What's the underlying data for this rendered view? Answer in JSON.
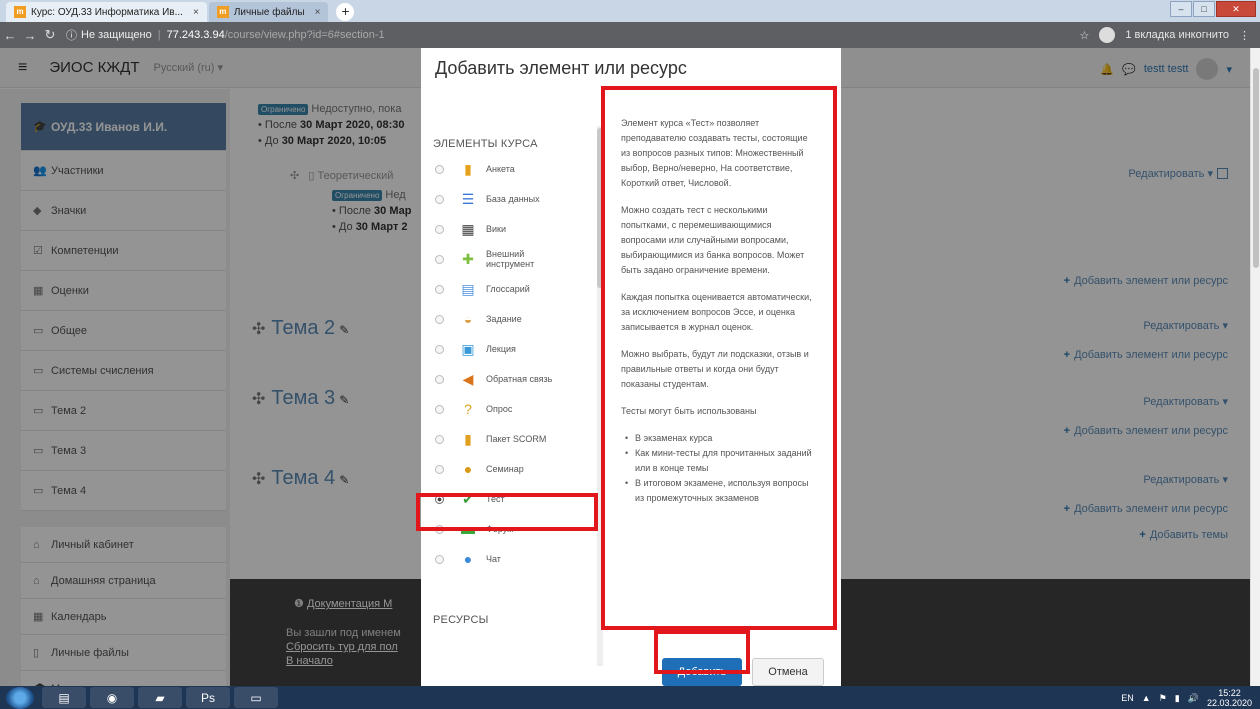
{
  "browser": {
    "tabs": [
      {
        "label": "Курс: ОУД.33 Информатика Ив...",
        "active": true
      },
      {
        "label": "Личные файлы",
        "active": false
      }
    ],
    "address": {
      "insecure_label": "Не защищено",
      "host": "77.243.3.94",
      "path": "/course/view.php?id=6#section-1"
    },
    "incognito_label": "1 вкладка инкогнито"
  },
  "header": {
    "brand": "ЭИОС КЖДТ",
    "language": "Русский (ru) ▾",
    "user": "testt testt"
  },
  "sidebar": {
    "items": [
      {
        "icon": "graduation-cap-icon",
        "glyph": "🎓",
        "label": "ОУД.33 Иванов И.И."
      },
      {
        "icon": "users-icon",
        "glyph": "👥",
        "label": "Участники"
      },
      {
        "icon": "badge-icon",
        "glyph": "◆",
        "label": "Значки"
      },
      {
        "icon": "checklist-icon",
        "glyph": "☑",
        "label": "Компетенции"
      },
      {
        "icon": "grades-table-icon",
        "glyph": "▦",
        "label": "Оценки"
      },
      {
        "icon": "folder-icon",
        "glyph": "▭",
        "label": "Общее"
      },
      {
        "icon": "folder-icon",
        "glyph": "▭",
        "label": "Системы счисления"
      },
      {
        "icon": "folder-icon",
        "glyph": "▭",
        "label": "Тема 2"
      },
      {
        "icon": "folder-icon",
        "glyph": "▭",
        "label": "Тема 3"
      },
      {
        "icon": "folder-icon",
        "glyph": "▭",
        "label": "Тема 4"
      },
      {
        "icon": "dashboard-icon",
        "glyph": "⌂",
        "label": "Личный кабинет"
      },
      {
        "icon": "home-icon",
        "glyph": "⌂",
        "label": "Домашняя страница"
      },
      {
        "icon": "calendar-icon",
        "glyph": "▦",
        "label": "Календарь"
      },
      {
        "icon": "file-icon",
        "glyph": "▯",
        "label": "Личные файлы"
      },
      {
        "icon": "courses-icon",
        "glyph": "🎓",
        "label": "Мои курсы"
      }
    ]
  },
  "main": {
    "restriction_badge": "Ограничено",
    "restriction_text": "Недоступно, пока",
    "restriction_text_short": "Нед",
    "after_prefix": "После",
    "after_date": "30 Март 2020, 08:30",
    "before_prefix": "До",
    "before_date": "30 Март 2020, 10:05",
    "after_date_short": "30 Мар",
    "before_date_short": "30 Март 2",
    "resource_label": "Теоретический",
    "topics": [
      "Тема 2",
      "Тема 3",
      "Тема 4"
    ],
    "edit_label": "Редактировать",
    "add_resource_label": "Добавить элемент или ресурс",
    "add_topics_label": "Добавить темы"
  },
  "footer": {
    "doc_link": "Документация М",
    "logged_in": "Вы зашли под именем",
    "reset_tour": "Сбросить тур для пол",
    "home": "В начало"
  },
  "modal": {
    "title": "Добавить элемент или ресурс",
    "section_activities": "ЭЛЕМЕНТЫ КУРСА",
    "section_resources": "РЕСУРСЫ",
    "modules": [
      {
        "label": "Анкета",
        "icon": "survey-chart-icon",
        "glyph": "▮",
        "color": "#e6a21c",
        "selected": false
      },
      {
        "label": "База данных",
        "icon": "database-icon",
        "glyph": "☰",
        "color": "#3a7ad6",
        "selected": false
      },
      {
        "label": "Вики",
        "icon": "wiki-icon",
        "glyph": "▦",
        "color": "#444444",
        "selected": false
      },
      {
        "label": "Внешний инструмент",
        "icon": "puzzle-icon",
        "glyph": "✚",
        "color": "#7fbf3f",
        "selected": false
      },
      {
        "label": "Глоссарий",
        "icon": "glossary-icon",
        "glyph": "▤",
        "color": "#4a90d9",
        "selected": false
      },
      {
        "label": "Задание",
        "icon": "assignment-icon",
        "glyph": "◒",
        "color": "#d9a04a",
        "selected": false
      },
      {
        "label": "Лекция",
        "icon": "lesson-icon",
        "glyph": "▣",
        "color": "#3a9ad9",
        "selected": false
      },
      {
        "label": "Обратная связь",
        "icon": "feedback-icon",
        "glyph": "◀",
        "color": "#d9741a",
        "selected": false
      },
      {
        "label": "Опрос",
        "icon": "question-icon",
        "glyph": "?",
        "color": "#d9a21a",
        "selected": false
      },
      {
        "label": "Пакет SCORM",
        "icon": "scorm-icon",
        "glyph": "▮",
        "color": "#e0a020",
        "selected": false
      },
      {
        "label": "Семинар",
        "icon": "workshop-icon",
        "glyph": "●",
        "color": "#d99a1a",
        "selected": false
      },
      {
        "label": "Тест",
        "icon": "quiz-check-icon",
        "glyph": "✔",
        "color": "#3a9a3a",
        "selected": true
      },
      {
        "label": "Форум",
        "icon": "forum-icon",
        "glyph": "▬",
        "color": "#3aa83a",
        "selected": false
      },
      {
        "label": "Чат",
        "icon": "chat-icon",
        "glyph": "●",
        "color": "#3a8ad9",
        "selected": false
      }
    ],
    "description": {
      "p1": "Элемент курса «Тест» позволяет преподавателю создавать тесты, состоящие из вопросов разных типов: Множественный выбор, Верно/неверно, На соответствие, Короткий ответ, Числовой.",
      "p2": "Можно создать тест с несколькими попытками, с перемешивающимися вопросами или случайными вопросами, выбирающимися из банка вопросов. Может быть задано ограничение времени.",
      "p3": "Каждая попытка оценивается автоматически, за исключением вопросов Эссе, и оценка записывается в журнал оценок.",
      "p4": "Можно выбрать, будут ли подсказки, отзыв и правильные ответы и когда они будут показаны студентам.",
      "p5": "Тесты могут быть использованы",
      "bullets": [
        "В экзаменах курса",
        "Как мини-тесты для прочитанных заданий или в конце темы",
        "В итоговом экзамене, используя вопросы из промежуточных экзаменов"
      ]
    },
    "add_button": "Добавить",
    "cancel_button": "Отмена"
  },
  "taskbar": {
    "lang": "EN",
    "time": "15:22",
    "date": "22.03.2020"
  },
  "colors": {
    "highlight": "#e1171b",
    "primary": "#1f6fb8",
    "link": "#5b8cb8",
    "sidebar_active": "#5b7fa6"
  }
}
